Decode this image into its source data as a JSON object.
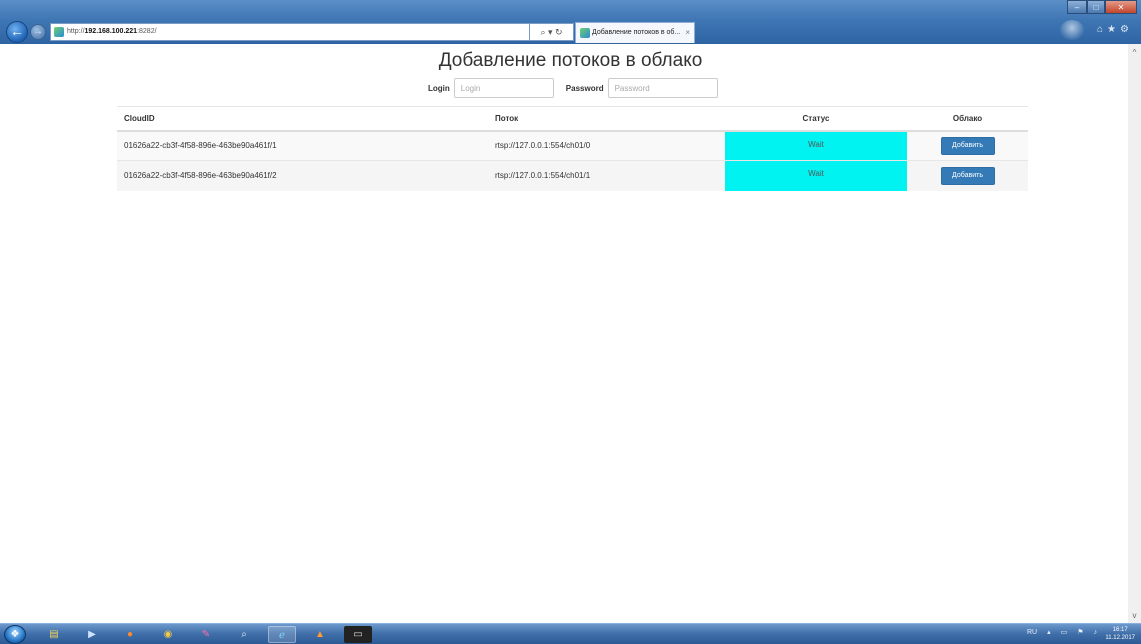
{
  "browser": {
    "url_prefix": "http://",
    "url_host": "192.168.100.221",
    "url_suffix": ":8282/",
    "address_tools": "⌕ ▾ ↻",
    "tab_title": "Добавление потоков в об...",
    "tab_close": "×",
    "win_min": "–",
    "win_max": "□",
    "win_close": "✕",
    "tools_icons": "⌂★⚙"
  },
  "page": {
    "title": "Добавление потоков в облако",
    "login_label": "Login",
    "login_placeholder": "Login",
    "password_label": "Password",
    "password_placeholder": "Password"
  },
  "table": {
    "headers": {
      "cloud_id": "CloudID",
      "stream": "Поток",
      "status": "Статус",
      "cloud": "Облако"
    },
    "rows": [
      {
        "cloud_id": "01626a22-cb3f-4f58-896e-463be90a461f/1",
        "stream": "rtsp://127.0.0.1:554/ch01/0",
        "status": "Wait",
        "action": "Добавить"
      },
      {
        "cloud_id": "01626a22-cb3f-4f58-896e-463be90a461f/2",
        "stream": "rtsp://127.0.0.1:554/ch01/1",
        "status": "Wait",
        "action": "Добавить"
      }
    ],
    "status_color": "#00f3f0",
    "button_color": "#337ab7"
  },
  "taskbar": {
    "lang": "RU",
    "clock_time": "16:17",
    "clock_date": "11.12.2017"
  }
}
